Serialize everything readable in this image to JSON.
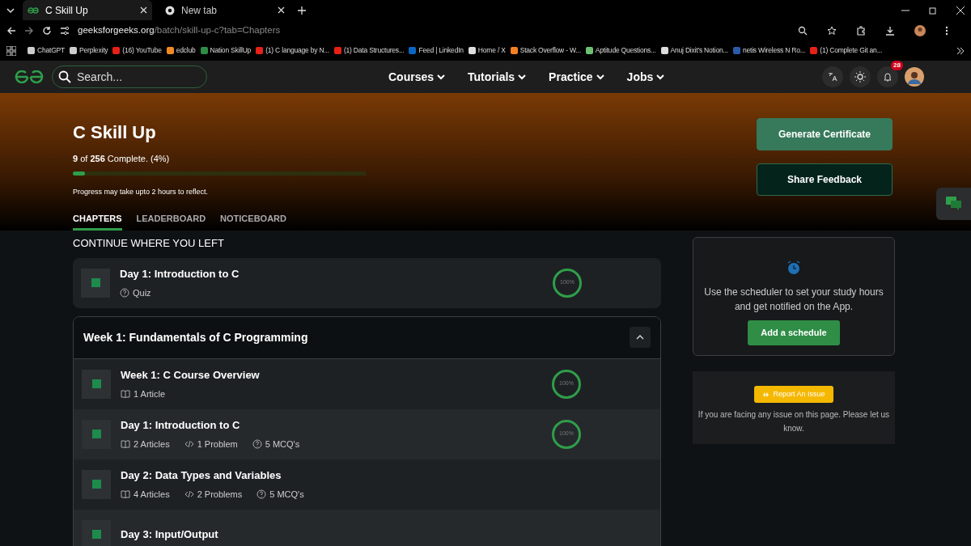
{
  "browser": {
    "tabs": [
      {
        "title": "C Skill Up",
        "selected": true
      },
      {
        "title": "New tab",
        "selected": false
      }
    ],
    "url": {
      "host": "geeksforgeeks.org",
      "path": "/batch/skill-up-c?tab=Chapters"
    },
    "bookmarks": [
      {
        "label": "ChatGPT",
        "color": "#cccccc"
      },
      {
        "label": "Perplexity",
        "color": "#cccccc"
      },
      {
        "label": "(16) YouTube",
        "color": "#e62117"
      },
      {
        "label": "edclub",
        "color": "#f08a24"
      },
      {
        "label": "Nation SkillUp",
        "color": "#2f8d46"
      },
      {
        "label": "(1) C language by N...",
        "color": "#e62117"
      },
      {
        "label": "(1) Data Structures...",
        "color": "#e62117"
      },
      {
        "label": "Feed | LinkedIn",
        "color": "#0a66c2"
      },
      {
        "label": "Home / X",
        "color": "#dddddd"
      },
      {
        "label": "Stack Overflow - W...",
        "color": "#f48024"
      },
      {
        "label": "Aptitude Questions...",
        "color": "#6fbf73"
      },
      {
        "label": "Anuj Dixit's Notion...",
        "color": "#dddddd"
      },
      {
        "label": "netis Wireless N Ro...",
        "color": "#2a5ba8"
      },
      {
        "label": "(1) Complete Git an...",
        "color": "#e62117"
      }
    ]
  },
  "site_nav": {
    "search": {
      "placeholder": "Search..."
    },
    "menus": [
      "Courses",
      "Tutorials",
      "Practice",
      "Jobs"
    ],
    "notification_count": "28"
  },
  "hero": {
    "title": "C Skill Up",
    "progress_text": "**9** of **256** Complete. (4%)",
    "level": 0.04,
    "note": "Progress may take upto 2 hours to reflect.",
    "buttons": [
      {
        "label": "Generate Certificate",
        "kind": "primary"
      },
      {
        "label": "Share Feedback",
        "kind": "outline"
      }
    ]
  },
  "tabs": [
    {
      "label": "CHAPTERS",
      "selected": true
    },
    {
      "label": "LEADERBOARD",
      "selected": false
    },
    {
      "label": "NOTICEBOARD",
      "selected": false
    }
  ],
  "continue": {
    "heading": "CONTINUE WHERE YOU LEFT",
    "item": {
      "title": "Day 1: Introduction to C",
      "meta": [
        {
          "kind": "quiz",
          "text": "Quiz"
        }
      ],
      "progress": "100%"
    }
  },
  "week": {
    "title": "Week 1: Fundamentals of C Programming",
    "expanded": true,
    "items": [
      {
        "title": "Week 1: C Course Overview",
        "meta": [
          {
            "kind": "article",
            "text": "1 Article"
          }
        ],
        "progress": "100%"
      },
      {
        "title": "Day 1: Introduction to C",
        "meta": [
          {
            "kind": "article",
            "text": "2 Articles"
          },
          {
            "kind": "problem",
            "text": "1 Problem"
          },
          {
            "kind": "quiz",
            "text": "5 MCQ's"
          }
        ],
        "progress": "100%"
      },
      {
        "title": "Day 2: Data Types and Variables",
        "meta": [
          {
            "kind": "article",
            "text": "4 Articles"
          },
          {
            "kind": "problem",
            "text": "2 Problems"
          },
          {
            "kind": "quiz",
            "text": "5 MCQ's"
          }
        ]
      },
      {
        "title": "Day 3: Input/Output"
      }
    ]
  },
  "scheduler": {
    "text": "Use the scheduler to set your study hours and get notified on the App.",
    "button": "Add a schedule"
  },
  "report": {
    "button": "Report An Issue",
    "text": "If you are facing any issue on this page. Please let us know."
  }
}
